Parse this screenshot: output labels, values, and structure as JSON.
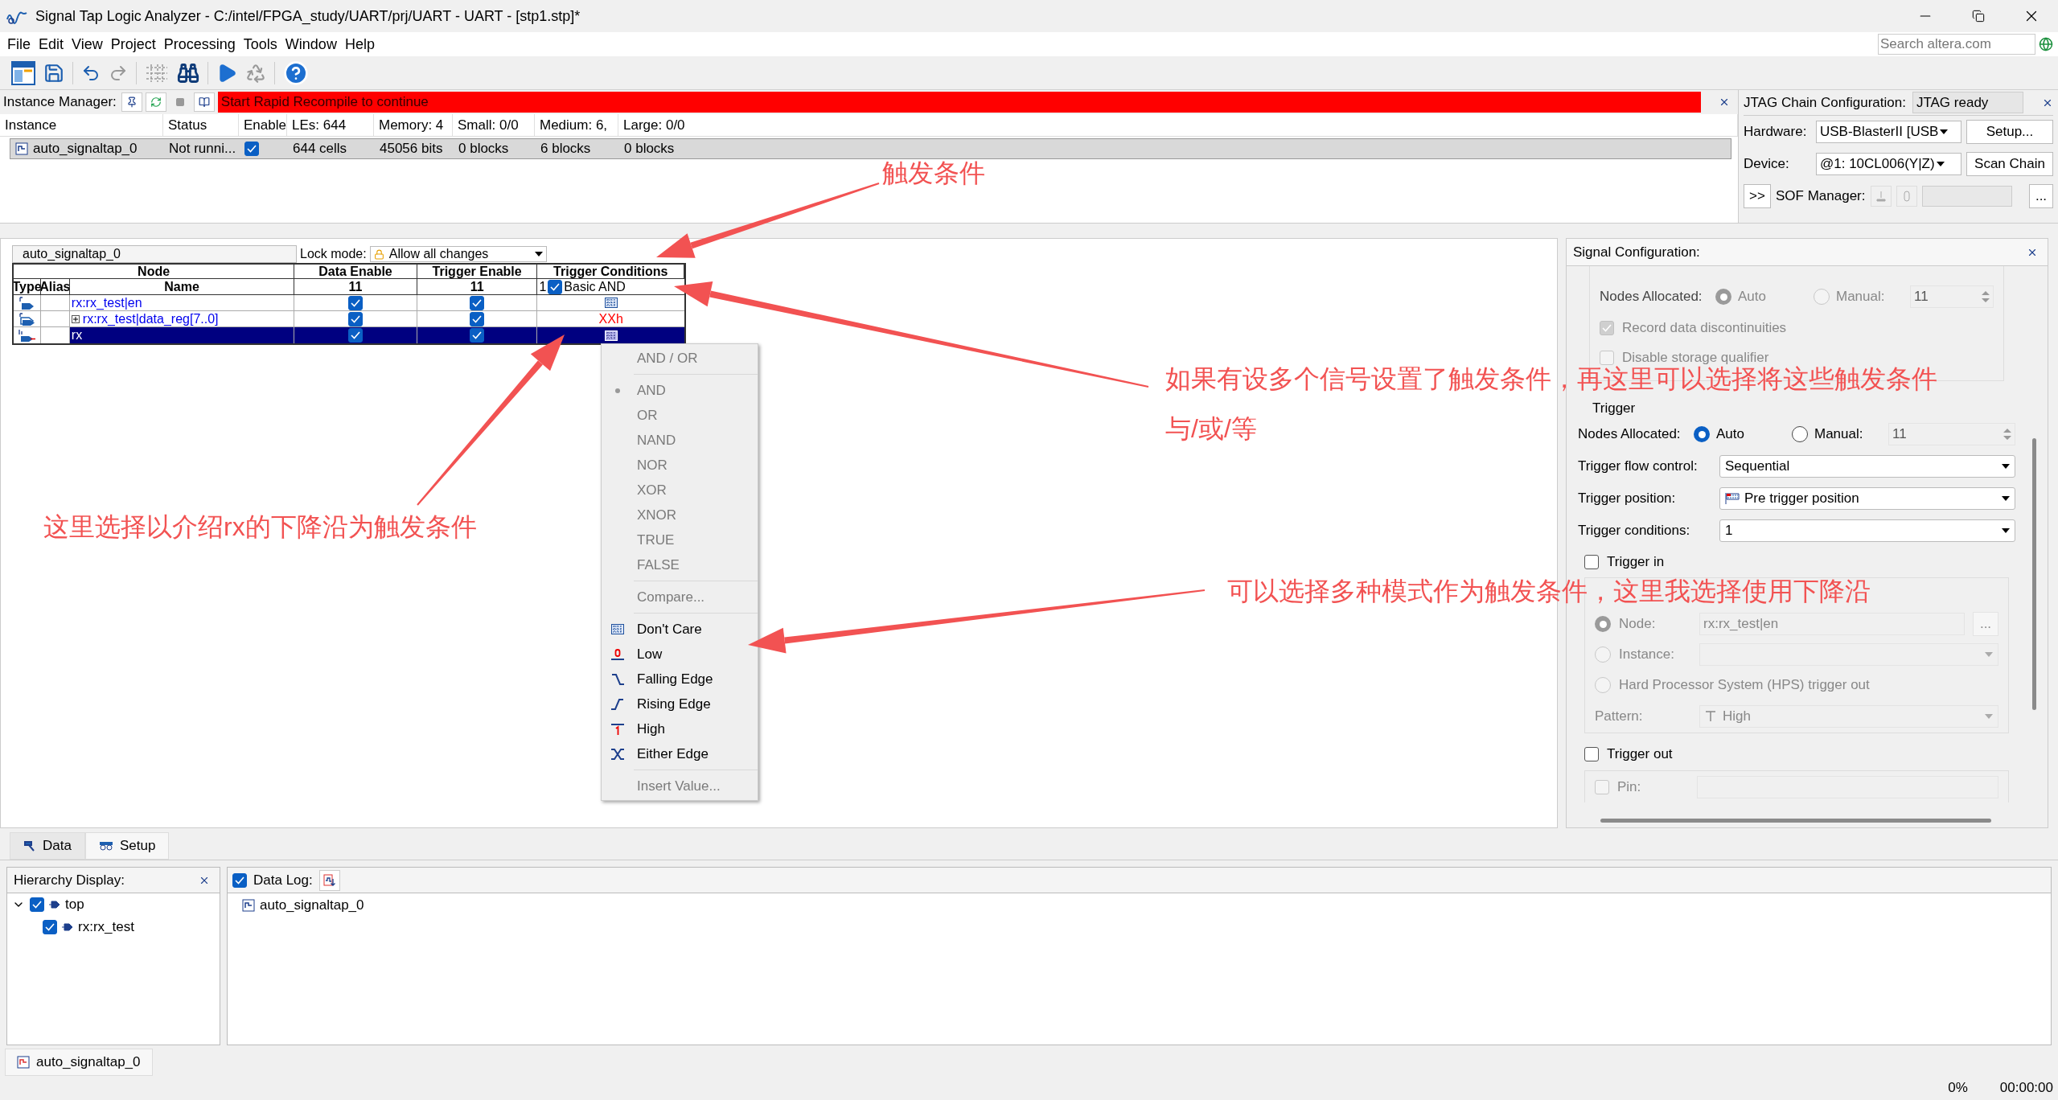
{
  "window": {
    "title": "Signal Tap Logic Analyzer - C:/intel/FPGA_study/UART/prj/UART - UART - [stp1.stp]*"
  },
  "menu": [
    "File",
    "Edit",
    "View",
    "Project",
    "Processing",
    "Tools",
    "Window",
    "Help"
  ],
  "search": {
    "placeholder": "Search altera.com"
  },
  "instance_manager": {
    "label": "Instance Manager:",
    "message": "Start Rapid Recompile to continue",
    "columns": [
      "Instance",
      "Status",
      "Enable",
      "LEs: 644",
      "Memory: 4",
      "Small: 0/0",
      "Medium: 6,",
      "Large: 0/0"
    ],
    "rows": [
      {
        "instance": "auto_signaltap_0",
        "status": "Not runni...",
        "enabled": true,
        "les": "644 cells",
        "memory": "45056 bits",
        "small": "0 blocks",
        "medium": "6 blocks",
        "large": "0 blocks",
        "selected": true
      }
    ]
  },
  "jtag": {
    "title": "JTAG Chain Configuration:",
    "status": "JTAG ready",
    "hardware_label": "Hardware:",
    "hardware": "USB-BlasterII [USB",
    "setup": "Setup...",
    "device_label": "Device:",
    "device": "@1: 10CL006(Y|Z)",
    "scan": "Scan Chain",
    "expand": ">>",
    "sof_label": "SOF Manager:",
    "browse": "..."
  },
  "setup": {
    "instance": "auto_signaltap_0",
    "lock_label": "Lock mode:",
    "lock_mode": "Allow all changes",
    "group_headers": [
      "Node",
      "Data Enable",
      "Trigger Enable",
      "Trigger Conditions"
    ],
    "columns": [
      "Type",
      "Alias",
      "Name"
    ],
    "data_count": "11",
    "trigger_count": "11",
    "condition": {
      "index": "1",
      "enabled": true,
      "type": "Basic AND"
    },
    "nodes": [
      {
        "kind": "register",
        "name": "rx:rx_test|en",
        "bus": false,
        "data_enable": true,
        "trigger_enable": true,
        "condition": {
          "kind": "dont_care"
        },
        "selected": false
      },
      {
        "kind": "register_bus",
        "name": "rx:rx_test|data_reg[7..0]",
        "bus": true,
        "data_enable": true,
        "trigger_enable": true,
        "condition": {
          "kind": "value",
          "text": "XXh"
        },
        "selected": false
      },
      {
        "kind": "input",
        "name": "rx",
        "bus": false,
        "data_enable": true,
        "trigger_enable": true,
        "condition": {
          "kind": "dont_care"
        },
        "selected": true
      }
    ]
  },
  "condition_menu": {
    "sections": [
      [
        {
          "label": "AND / OR",
          "disabled": true
        }
      ],
      [
        {
          "label": "AND",
          "disabled": true,
          "selected": true
        },
        {
          "label": "OR",
          "disabled": true,
          "selected": false
        },
        {
          "label": "NAND",
          "disabled": true,
          "selected": false
        },
        {
          "label": "NOR",
          "disabled": true,
          "selected": false
        },
        {
          "label": "XOR",
          "disabled": true,
          "selected": false
        },
        {
          "label": "XNOR",
          "disabled": true,
          "selected": false
        },
        {
          "label": "TRUE",
          "disabled": true,
          "selected": false
        },
        {
          "label": "FALSE",
          "disabled": true,
          "selected": false
        }
      ],
      [
        {
          "label": "Compare...",
          "disabled": true
        }
      ],
      [
        {
          "label": "Don't Care",
          "disabled": false,
          "kind": "dont_care"
        },
        {
          "label": "Low",
          "disabled": false,
          "kind": "low"
        },
        {
          "label": "Falling Edge",
          "disabled": false,
          "kind": "falling"
        },
        {
          "label": "Rising Edge",
          "disabled": false,
          "kind": "rising"
        },
        {
          "label": "High",
          "disabled": false,
          "kind": "high"
        },
        {
          "label": "Either Edge",
          "disabled": false,
          "kind": "either"
        }
      ],
      [
        {
          "label": "Insert Value...",
          "disabled": true
        }
      ]
    ]
  },
  "signal_config": {
    "title": "Signal Configuration:",
    "storage": {
      "nodes_label": "Nodes Allocated:",
      "auto": "Auto",
      "manual": "Manual:",
      "value": "11",
      "auto_selected": true,
      "manual_selected": false,
      "disabled": true,
      "checks": [
        {
          "label": "Record data discontinuities",
          "checked": true,
          "disabled": true
        },
        {
          "label": "Disable storage qualifier",
          "checked": false,
          "disabled": true
        }
      ]
    },
    "trigger": {
      "title": "Trigger",
      "nodes_label": "Nodes Allocated:",
      "auto": "Auto",
      "manual": "Manual:",
      "value": "11",
      "auto_selected": true,
      "manual_selected": false,
      "fields": [
        {
          "label": "Trigger flow control:",
          "value": "Sequential",
          "flag": false
        },
        {
          "label": "Trigger position:",
          "value": "Pre trigger position",
          "flag": true
        },
        {
          "label": "Trigger conditions:",
          "value": "1",
          "flag": false
        }
      ],
      "trigger_in": {
        "label": "Trigger in",
        "checked": false,
        "node_label": "Node:",
        "node_value": "rx:rx_test|en",
        "node_selected": true,
        "browse": "...",
        "instance_label": "Instance:",
        "instance_selected": false,
        "hps_label": "Hard Processor System (HPS) trigger out",
        "hps_selected": false,
        "pattern_label": "Pattern:",
        "pattern": "High"
      },
      "trigger_out": {
        "label": "Trigger out",
        "checked": false,
        "pin_label": "Pin:",
        "pin_checked": false
      }
    }
  },
  "tabs": [
    {
      "label": "Data",
      "selected": false
    },
    {
      "label": "Setup",
      "selected": true
    }
  ],
  "hierarchy": {
    "title": "Hierarchy Display:",
    "tree": [
      {
        "label": "top",
        "checked": true,
        "expanded": true,
        "children": [
          {
            "label": "rx:rx_test",
            "checked": true
          }
        ]
      }
    ]
  },
  "data_log": {
    "label": "Data Log:",
    "checked": true,
    "items": [
      "auto_signaltap_0"
    ]
  },
  "instance_tab": "auto_signaltap_0",
  "status_bar": {
    "progress": "0%",
    "time": "00:00:00"
  },
  "annotations": [
    {
      "lines": [
        "触发条件"
      ]
    },
    {
      "lines": [
        "如果有设多个信号设置了触发条件，再这里可以选择将这些触发条件",
        "与/或/等"
      ]
    },
    {
      "lines": [
        "这里选择以介绍rx的下降沿为触发条件"
      ]
    },
    {
      "lines": [
        "可以选择多种模式作为触发条件，这里我选择使用下降沿"
      ]
    }
  ]
}
